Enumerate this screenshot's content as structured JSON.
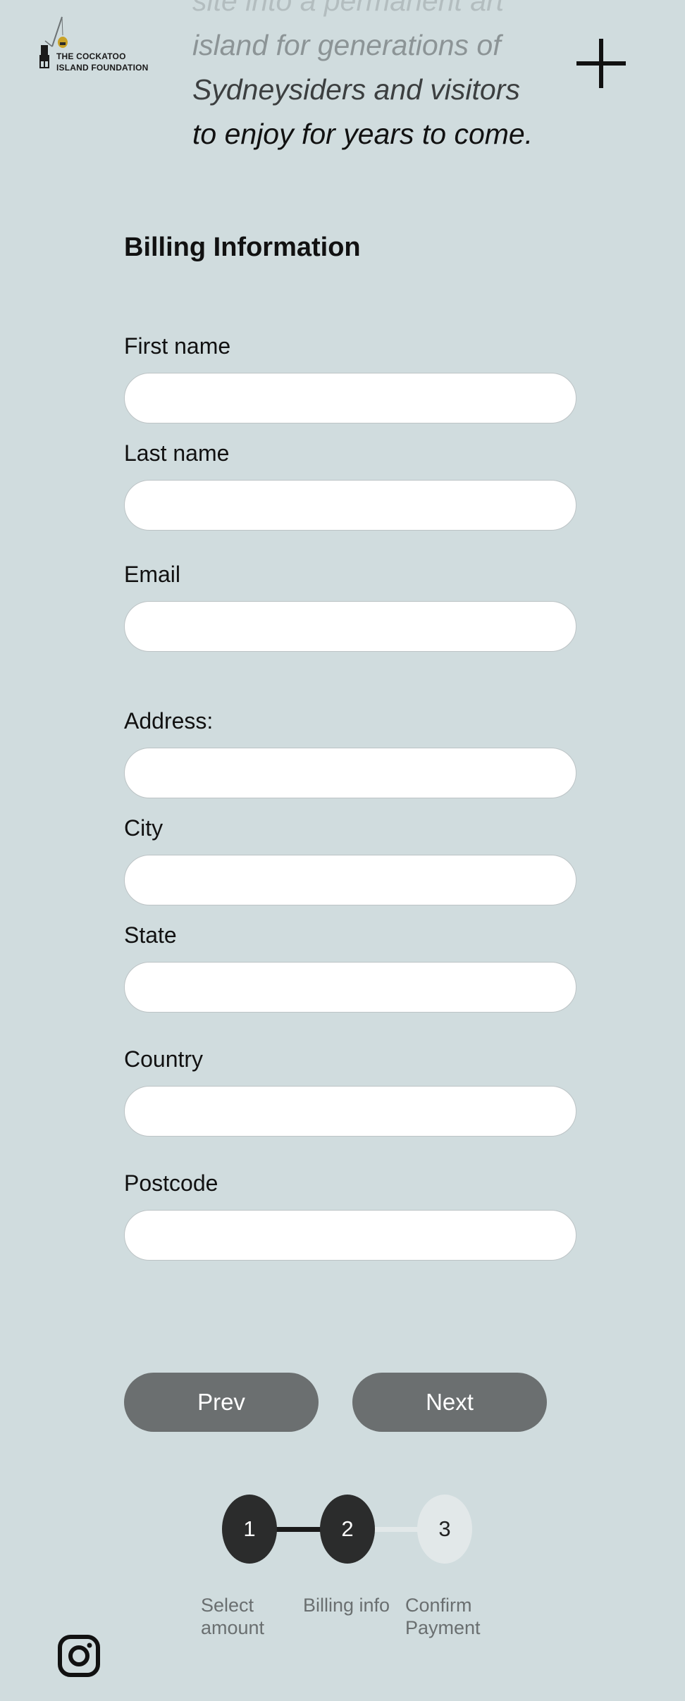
{
  "header": {
    "logo_text_line1": "THE COCKATOO",
    "logo_text_line2": "ISLAND FOUNDATION",
    "intro_lines": [
      "site into a permanent art",
      "island for generations of",
      "Sydneysiders and visitors",
      "to enjoy for years to come."
    ]
  },
  "form": {
    "title": "Billing Information",
    "fields": [
      {
        "label": "First name",
        "value": ""
      },
      {
        "label": "Last name",
        "value": ""
      },
      {
        "label": "Email",
        "value": ""
      },
      {
        "label": "Address:",
        "value": ""
      },
      {
        "label": "City",
        "value": ""
      },
      {
        "label": "State",
        "value": ""
      },
      {
        "label": "Country",
        "value": ""
      },
      {
        "label": "Postcode",
        "value": ""
      }
    ]
  },
  "buttons": {
    "prev": "Prev",
    "next": "Next"
  },
  "stepper": {
    "current_step": 2,
    "steps": [
      {
        "number": "1",
        "label_line1": "Select",
        "label_line2": "amount"
      },
      {
        "number": "2",
        "label_line1": "Billing info",
        "label_line2": ""
      },
      {
        "number": "3",
        "label_line1": "Confirm",
        "label_line2": "Payment"
      }
    ]
  },
  "colors": {
    "background": "#d0dcde",
    "button": "#6b6f70",
    "step_active": "#2b2c2c",
    "step_inactive": "#e2e8e9",
    "logo_accent": "#c9a227"
  },
  "icons": {
    "menu": "plus-icon",
    "social": "instagram-icon",
    "logo": "crane-logo-icon"
  }
}
